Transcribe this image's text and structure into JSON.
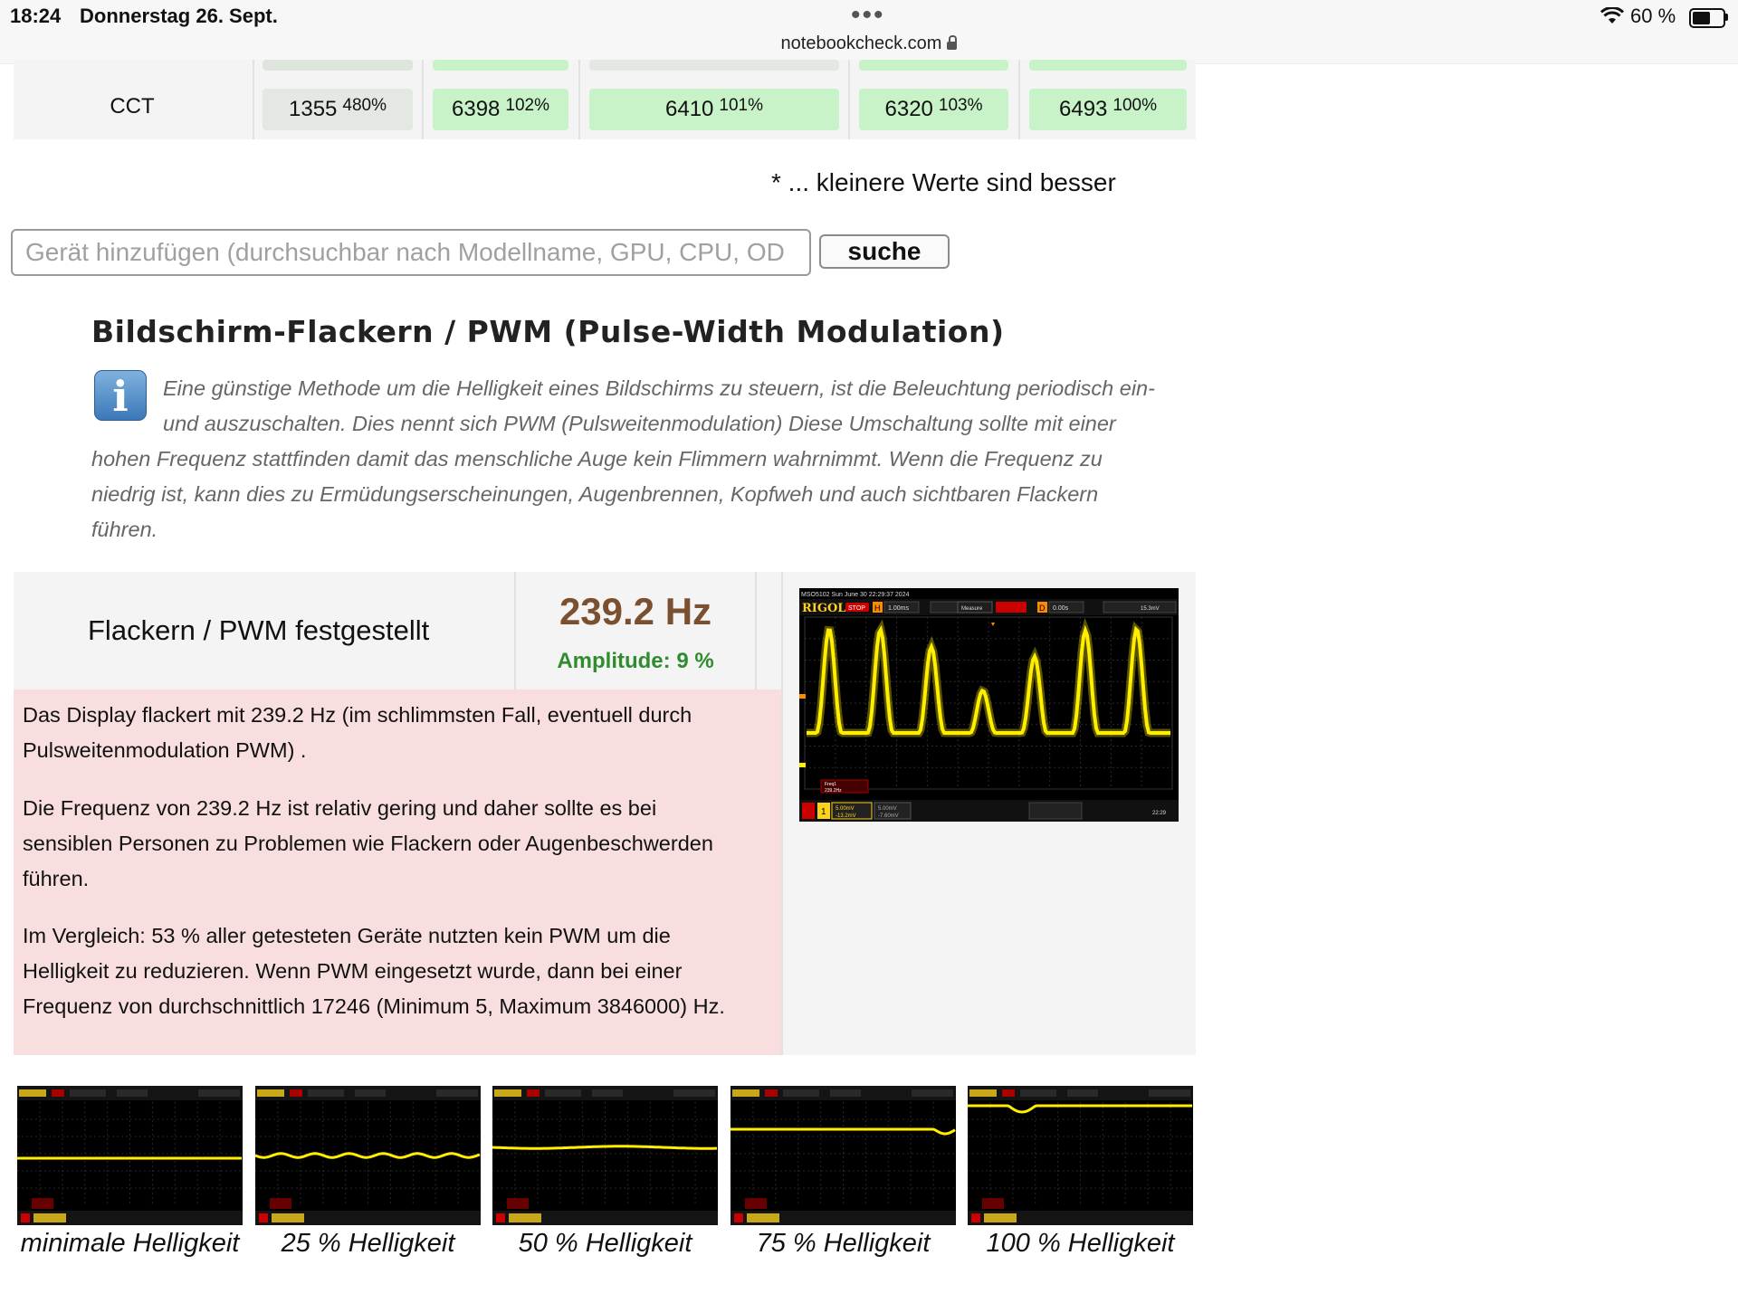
{
  "status_bar": {
    "time": "18:24",
    "date": "Donnerstag 26. Sept.",
    "url": "notebookcheck.com",
    "battery_percent_label": "60 %",
    "battery_level": 0.6
  },
  "cct_row": {
    "label": "CCT",
    "cells": [
      {
        "value": "1355",
        "percent": "480%"
      },
      {
        "value": "6398",
        "percent": "102%"
      },
      {
        "value": "6410",
        "percent": "101%"
      },
      {
        "value": "6320",
        "percent": "103%"
      },
      {
        "value": "6493",
        "percent": "100%"
      }
    ]
  },
  "footnote": "* ... kleinere Werte sind besser",
  "search": {
    "placeholder": "Gerät hinzufügen (durchsuchbar nach Modellname, GPU, CPU, OD",
    "button_label": "suche"
  },
  "section": {
    "title": "Bildschirm-Flackern / PWM (Pulse-Width Modulation)",
    "info_lines": [
      "Eine günstige Methode um die Helligkeit eines Bildschirms zu steuern, ist die Beleuchtung periodisch ein-",
      "und auszuschalten. Dies nennt sich PWM (Pulsweitenmodulation) Diese Umschaltung sollte mit einer",
      "hohen Frequenz stattfinden damit das menschliche Auge kein Flimmern wahrnimmt. Wenn die Frequenz zu",
      "niedrig ist, kann dies zu Ermüdungserscheinungen, Augenbrennen, Kopfweh und auch sichtbaren Flackern",
      "führen."
    ]
  },
  "result": {
    "label": "Flackern / PWM festgestellt",
    "frequency": "239.2 Hz",
    "amplitude": "Amplitude: 9 %",
    "description_lines": [
      "Das Display flackert mit 239.2 Hz (im schlimmsten Fall, eventuell durch",
      "Pulsweitenmodulation PWM) .",
      "Die Frequenz von 239.2 Hz ist relativ gering und daher sollte es bei",
      "sensiblen Personen zu Problemen wie Flackern oder Augenbeschwerden",
      "führen.",
      "Im Vergleich: 53 % aller getesteten Geräte nutzten kein PWM um die",
      "Helligkeit zu reduzieren. Wenn PWM eingesetzt wurde, dann bei einer",
      "Frequenz von durchschnittlich 17246 (Minimum 5, Maximum 3846000) Hz."
    ]
  },
  "scope_main": {
    "header_text": "MSO5102  Sun June 30 22:29:37 2024",
    "brand": "RIGOL",
    "status": "STOP",
    "timebase": "1.00ms",
    "trigger_offset": "0.00s",
    "trigger_level": "15.3mV",
    "measure_label": "Measure",
    "freq_label": "Freq1",
    "freq_value": "239.2Hz",
    "ch1_scale": "5.00mV",
    "ch1_offset": "-13.2mV",
    "ch2_scale": "5.00mV",
    "ch2_offset": "-7.60mV",
    "clock": "22:29"
  },
  "thumbnails": [
    {
      "caption": "minimale Helligkeit"
    },
    {
      "caption": "25 % Helligkeit"
    },
    {
      "caption": "50 % Helligkeit"
    },
    {
      "caption": "75 % Helligkeit"
    },
    {
      "caption": "100 % Helligkeit"
    }
  ],
  "colors": {
    "cell_green": "#c8f2c8",
    "frequency_brown": "#7a5030",
    "amplitude_green": "#2f8c2f",
    "warning_bg": "#f8dede",
    "scope_trace": "#ffee00"
  }
}
